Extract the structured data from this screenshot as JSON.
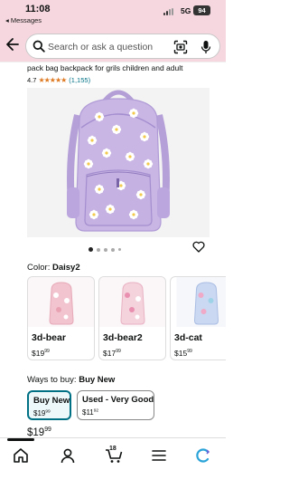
{
  "status_bar": {
    "time": "11:08",
    "back_app": "◂ Messages",
    "network": "5G",
    "battery": "94"
  },
  "search": {
    "placeholder": "Search or ask a question",
    "icons": [
      "magnifier-icon",
      "camera-scan-icon",
      "microphone-icon"
    ]
  },
  "product": {
    "title": "pack bag backpack for grils children and adult",
    "rating": "4.7",
    "stars": "★★★★★",
    "review_count": "(1,155)",
    "image_count": 5,
    "active_image": 0,
    "colors": {
      "accent": "#007185",
      "header_bg": "#f6d7df",
      "star": "#de7921",
      "backpack": "#c9b6e4"
    }
  },
  "color": {
    "label": "Color:",
    "selected": "Daisy2"
  },
  "variants": [
    {
      "name": "3d-bear",
      "price_whole": "$19",
      "price_cents": "99"
    },
    {
      "name": "3d-bear2",
      "price_whole": "$17",
      "price_cents": "99"
    },
    {
      "name": "3d-cat",
      "price_whole": "$15",
      "price_cents": "99"
    }
  ],
  "ways_to_buy": {
    "label": "Ways to buy:",
    "selected": "Buy New",
    "options": [
      {
        "label": "Buy New",
        "price_whole": "$19",
        "price_cents": "99"
      },
      {
        "label": "Used - Very Good",
        "price_whole": "$11",
        "price_cents": "92"
      }
    ]
  },
  "price": {
    "whole": "$19",
    "cents": "99"
  },
  "bottom_nav": {
    "cart_count": "18",
    "items": [
      "home-icon",
      "account-icon",
      "cart-icon",
      "menu-icon",
      "rufus-icon"
    ]
  }
}
